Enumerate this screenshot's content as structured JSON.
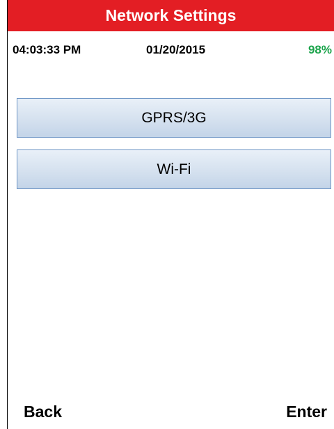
{
  "header": {
    "title": "Network Settings",
    "accent_color": "#e31e24"
  },
  "status": {
    "time": "04:03:33 PM",
    "date": "01/20/2015",
    "battery": "98%",
    "battery_color": "#1aa34a"
  },
  "menu": {
    "items": [
      {
        "label": "GPRS/3G"
      },
      {
        "label": "Wi-Fi"
      }
    ]
  },
  "softkeys": {
    "back_label": "Back",
    "enter_label": "Enter"
  }
}
